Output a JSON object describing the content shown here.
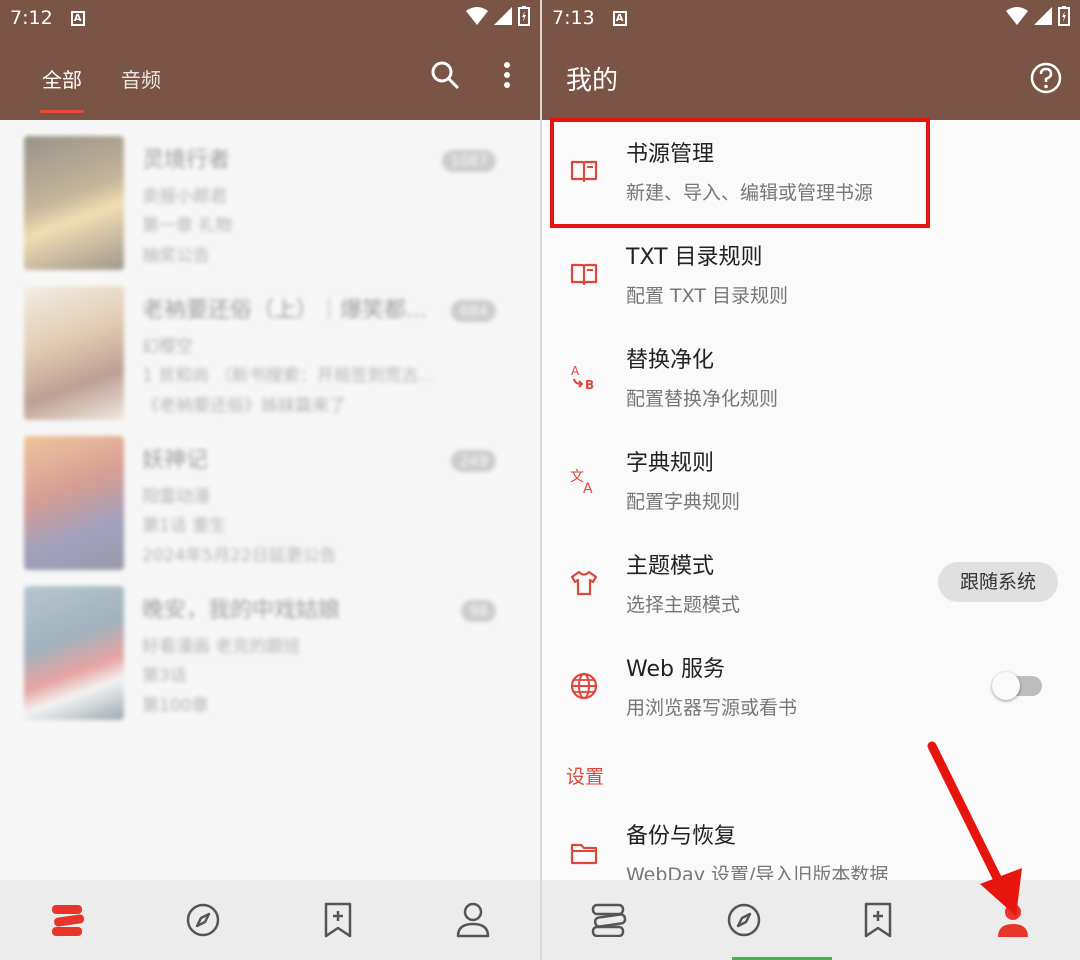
{
  "left": {
    "status": {
      "time": "7:12"
    },
    "tabs": [
      {
        "label": "全部"
      },
      {
        "label": "音频"
      }
    ],
    "books": [
      {
        "title": "灵境行者",
        "author": "卖报小郎君",
        "chapter": "第一章 礼物",
        "latest": "抽奖公告",
        "count": "1087",
        "cover_color": "#6b4a1f"
      },
      {
        "title": "老衲要还俗（上）｜爆笑都...",
        "author": "幻樱空",
        "chapter": "1 贫和尚 （新书搜索：开局签到荒古...",
        "latest": "《老衲要还俗》姊妹篇来了",
        "count": "684",
        "cover_color": "#b8865a"
      },
      {
        "title": "妖神记",
        "author": "阳雷动漫",
        "chapter": "第1话 重生",
        "latest": "2024年5月22日延更公告",
        "count": "249",
        "cover_color": "#b2331f"
      },
      {
        "title": "晚安，我的中戏姑娘",
        "author": "好看漫画 老克的跟班",
        "chapter": "第3话",
        "latest": "第100章",
        "count": "98",
        "cover_color": "#3d6278"
      }
    ]
  },
  "right": {
    "status": {
      "time": "7:13"
    },
    "title": "我的",
    "menu": [
      {
        "title": "书源管理",
        "subtitle": "新建、导入、编辑或管理书源",
        "icon": "book-open-icon"
      },
      {
        "title": "TXT 目录规则",
        "subtitle": "配置 TXT 目录规则",
        "icon": "book-open-icon"
      },
      {
        "title": "替换净化",
        "subtitle": "配置替换净化规则",
        "icon": "replace-ab-icon"
      },
      {
        "title": "字典规则",
        "subtitle": "配置字典规则",
        "icon": "translate-icon"
      },
      {
        "title": "主题模式",
        "subtitle": "选择主题模式",
        "icon": "shirt-icon"
      },
      {
        "title": "Web 服务",
        "subtitle": "用浏览器写源或看书",
        "icon": "globe-icon"
      }
    ],
    "theme_value": "跟随系统",
    "web_service_enabled": false,
    "section_settings": "设置",
    "backup": {
      "title": "备份与恢复",
      "subtitle": "WebDav 设置/导入旧版本数据",
      "icon": "folder-icon"
    }
  },
  "colors": {
    "appbar": "#7a5444",
    "accent": "#e84a3c",
    "highlight": "#e8150f"
  }
}
